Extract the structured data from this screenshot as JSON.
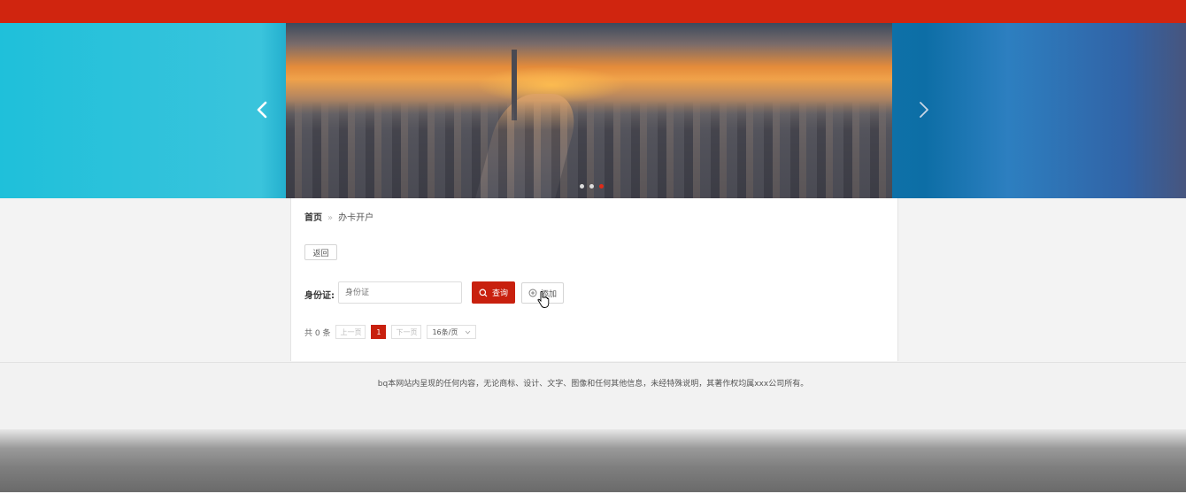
{
  "colors": {
    "brand_red": "#c8200e",
    "topbar": "#d0250f",
    "footer_bg": "#f2f2f2"
  },
  "banner": {
    "prev_icon": "chevron-left-icon",
    "next_icon": "chevron-right-icon",
    "slide_count": 3,
    "active_slide": 3
  },
  "breadcrumb": {
    "home": "首页",
    "separator": "»",
    "current": "办卡开户"
  },
  "actions": {
    "back_label": "返回"
  },
  "search": {
    "id_label": "身份证:",
    "id_placeholder": "身份证",
    "id_value": "",
    "query_label": "查询",
    "query_icon": "search-icon",
    "add_label": "添加",
    "add_icon": "plus-circle-icon"
  },
  "pagination": {
    "total_text": "共 0 条",
    "prev_label": "上一页",
    "current_page": "1",
    "next_label": "下一页",
    "page_size": "16条/页"
  },
  "footer": {
    "copyright": "bq本网站内呈现的任何内容，无论商标、设计、文字、图像和任何其他信息，未经特殊说明，其著作权均属xxx公司所有。"
  }
}
